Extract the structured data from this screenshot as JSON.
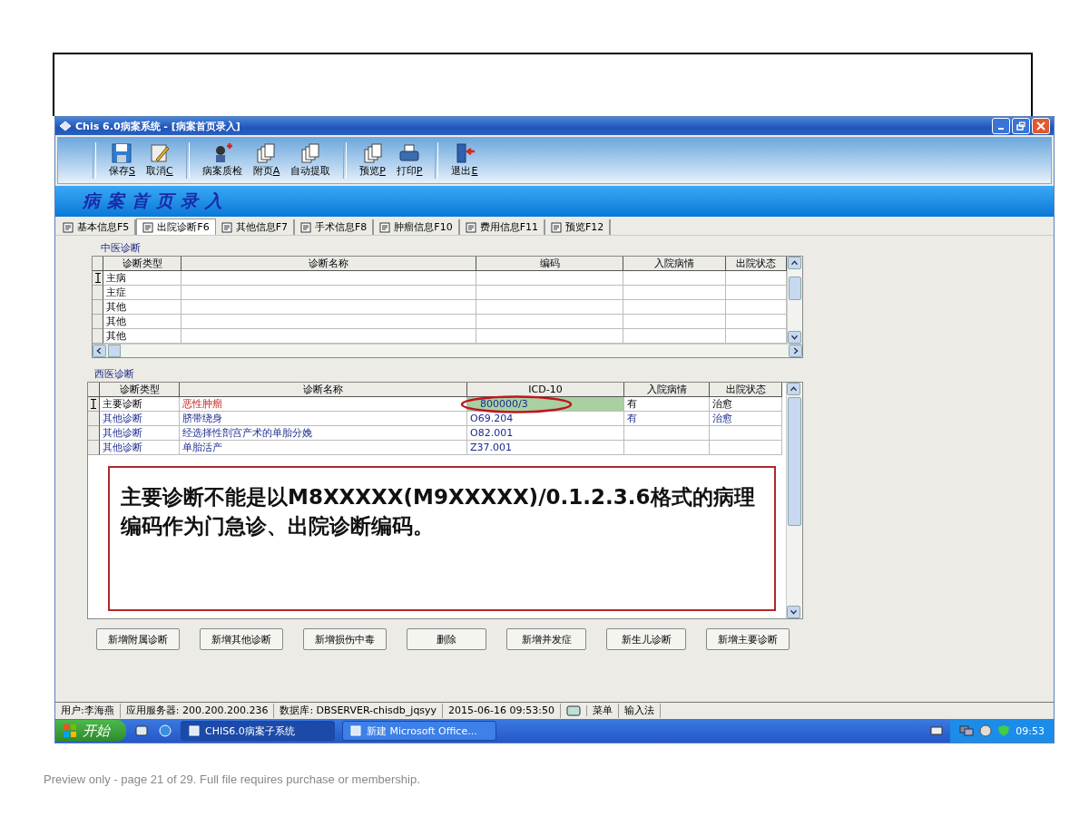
{
  "window": {
    "title": "Chis 6.0病案系统 - [病案首页录入]"
  },
  "toolbar": {
    "groups": [
      {
        "buttons": [
          {
            "kind": "save",
            "label": "保存",
            "key": "S"
          },
          {
            "kind": "cancel",
            "label": "取消",
            "key": "C"
          }
        ]
      },
      {
        "buttons": [
          {
            "kind": "check",
            "label": "病案质检"
          },
          {
            "kind": "pages",
            "label": "附页",
            "key": "A"
          },
          {
            "kind": "pages",
            "label": "自动提取"
          }
        ]
      },
      {
        "buttons": [
          {
            "kind": "pages",
            "label": "预览",
            "key": "P"
          },
          {
            "kind": "print",
            "label": "打印",
            "key": "P"
          }
        ]
      },
      {
        "buttons": [
          {
            "kind": "exit",
            "label": "退出",
            "key": "E"
          }
        ]
      }
    ]
  },
  "banner": {
    "title": "病案首页录入"
  },
  "tabs": [
    {
      "label": "基本信息F5",
      "selected": false
    },
    {
      "label": "出院诊断F6",
      "selected": true
    },
    {
      "label": "其他信息F7",
      "selected": false
    },
    {
      "label": "手术信息F8",
      "selected": false
    },
    {
      "label": "肿瘤信息F10",
      "selected": false
    },
    {
      "label": "费用信息F11",
      "selected": false
    },
    {
      "label": "预览F12",
      "selected": false
    }
  ],
  "tcm_diagnosis": {
    "label": "中医诊断",
    "columns": [
      "诊断类型",
      "诊断名称",
      "编码",
      "入院病情",
      "出院状态"
    ],
    "rows": [
      {
        "type": "主病",
        "selected": true
      },
      {
        "type": "主症",
        "selected": false
      },
      {
        "type": "其他",
        "selected": false
      },
      {
        "type": "其他",
        "selected": false
      },
      {
        "type": "其他",
        "selected": false
      }
    ]
  },
  "western_diagnosis": {
    "label": "西医诊断",
    "columns": [
      "诊断类型",
      "诊断名称",
      "ICD-10",
      "入院病情",
      "出院状态"
    ],
    "rows": [
      {
        "type": "主要诊断",
        "name": "恶性肿瘤",
        "code": "800000/3",
        "admission": "有",
        "discharge": "治愈",
        "selected": true,
        "invalid": true
      },
      {
        "type": "其他诊断",
        "name": "脐带绕身",
        "code": "O69.204",
        "admission": "有",
        "discharge": "治愈",
        "selected": false,
        "invalid": false
      },
      {
        "type": "其他诊断",
        "name": "经选择性剖宫产术的单胎分娩",
        "code": "O82.001",
        "selected": false,
        "invalid": false
      },
      {
        "type": "其他诊断",
        "name": "单胎活产",
        "code": "Z37.001",
        "selected": false,
        "invalid": false
      }
    ]
  },
  "message": {
    "text": "主要诊断不能是以M8XXXXX(M9XXXXX)/0.1.2.3.6格式的病理编码作为门急诊、出院诊断编码。"
  },
  "buttons": [
    "新增附属诊断",
    "新增其他诊断",
    "新增损伤中毒",
    "删除",
    "新增并发症",
    "新生儿诊断",
    "新增主要诊断"
  ],
  "status_bar": [
    {
      "kind": "text",
      "text": "用户:李海燕"
    },
    {
      "kind": "text",
      "text": "应用服务器: 200.200.200.236"
    },
    {
      "kind": "text",
      "text": "数据库: DBSERVER-chisdb_jqsyy"
    },
    {
      "kind": "text",
      "text": "2015-06-16 09:53:50"
    },
    {
      "kind": "icon"
    },
    {
      "kind": "text",
      "text": "菜单"
    },
    {
      "kind": "text",
      "text": "输入法"
    }
  ],
  "taskbar": {
    "start": "开始",
    "tasks": [
      {
        "label": "CHIS6.0病案子系统",
        "selected": true
      },
      {
        "label": "新建 Microsoft Office...",
        "selected": false
      }
    ],
    "clock": "09:53"
  },
  "footer": {
    "text": "Preview only - page 21 of 29. Full file requires purchase or membership."
  }
}
